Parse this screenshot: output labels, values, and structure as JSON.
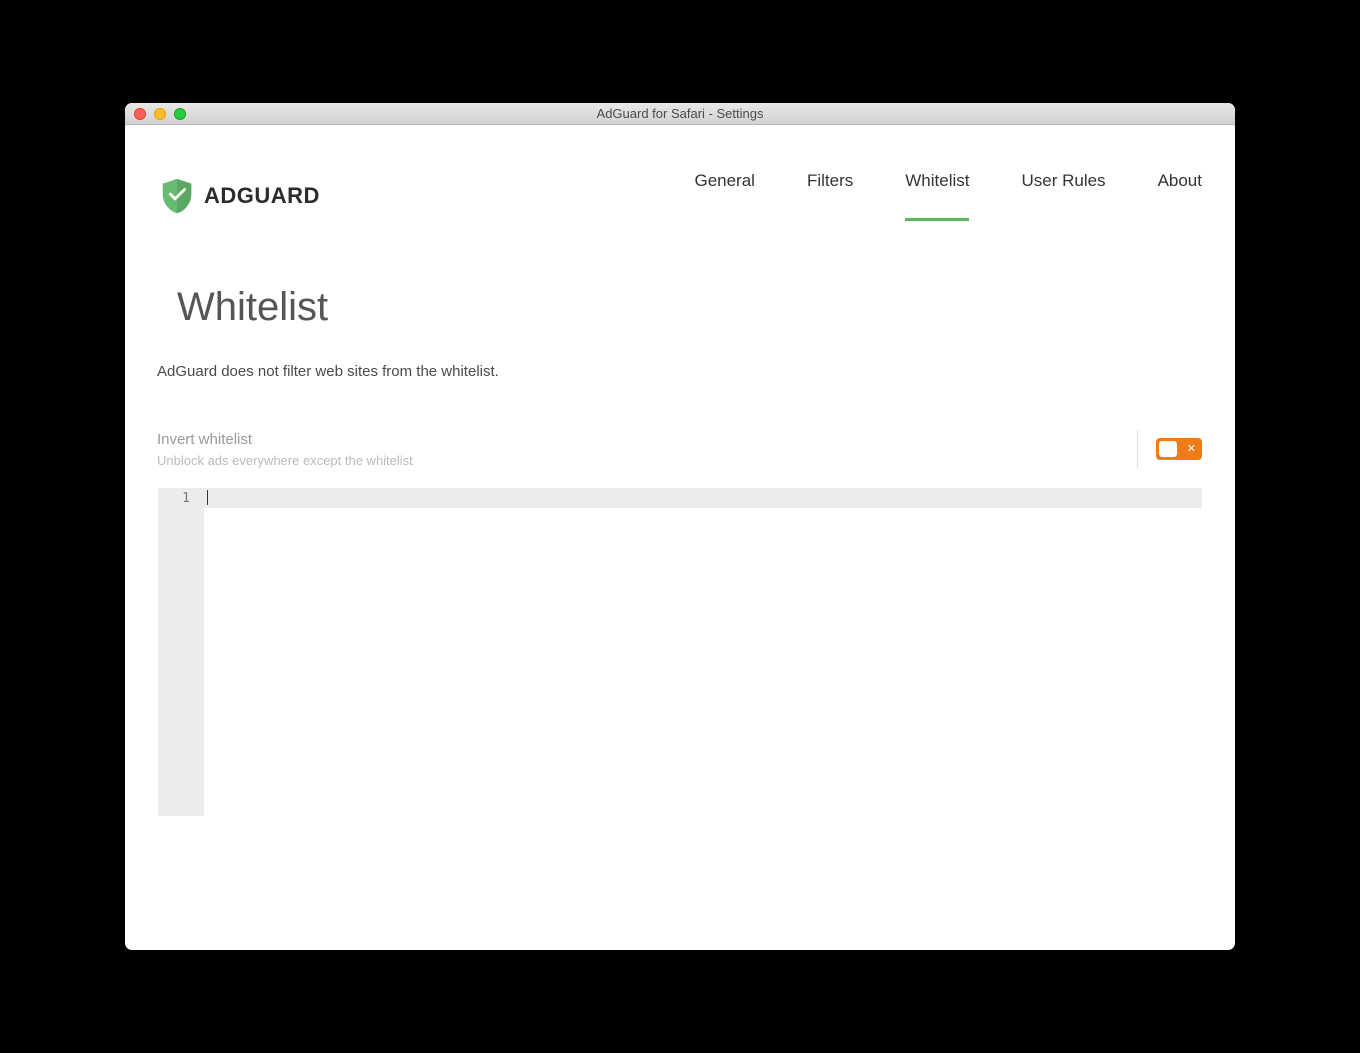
{
  "window": {
    "title": "AdGuard for Safari - Settings"
  },
  "header": {
    "brand": "ADGUARD",
    "nav": [
      {
        "label": "General",
        "active": false
      },
      {
        "label": "Filters",
        "active": false
      },
      {
        "label": "Whitelist",
        "active": true
      },
      {
        "label": "User Rules",
        "active": false
      },
      {
        "label": "About",
        "active": false
      }
    ]
  },
  "page": {
    "title": "Whitelist",
    "description": "AdGuard does not filter web sites from the whitelist."
  },
  "setting": {
    "label": "Invert whitelist",
    "sublabel": "Unblock ads everywhere except the whitelist",
    "toggle_state": "off"
  },
  "editor": {
    "lines": [
      "1"
    ],
    "content": ""
  },
  "colors": {
    "accent_green": "#5cb85c",
    "accent_orange": "#ed7c19"
  }
}
